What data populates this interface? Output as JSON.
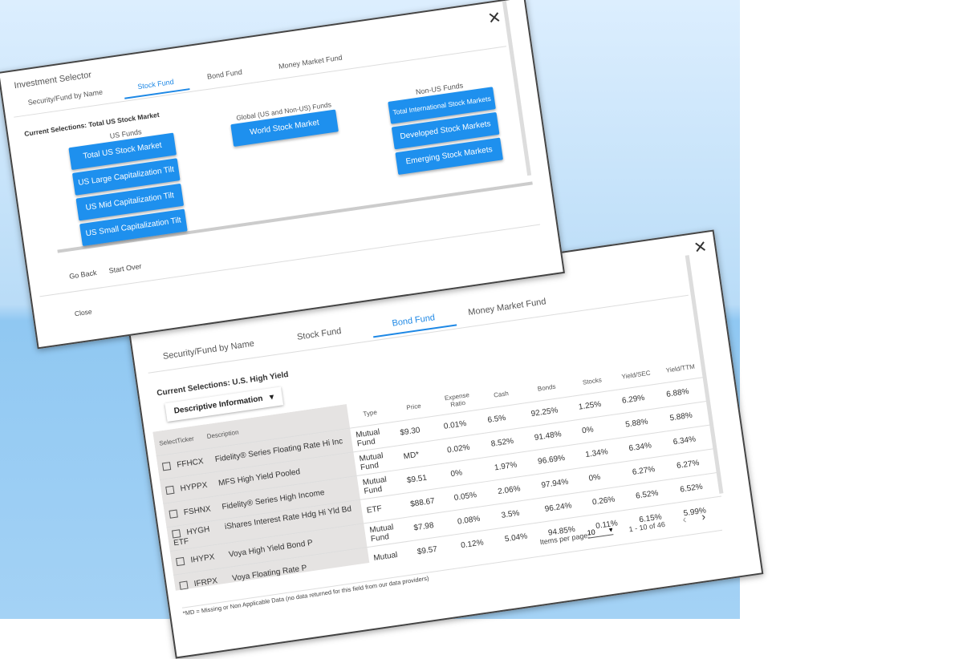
{
  "back_dialog": {
    "close_icon": "close-icon",
    "tabs": [
      "Security/Fund by Name",
      "Stock Fund",
      "Bond Fund",
      "Money Market Fund"
    ],
    "active_tab": "Bond Fund",
    "current_selection": "Current Selections: U.S. High Yield",
    "dropdown_label": "Descriptive Information",
    "columns": {
      "select": "Select",
      "ticker": "Ticker",
      "description": "Description",
      "type": "Type",
      "price": "Price",
      "expense": "Expense Ratio",
      "cash": "Cash",
      "bonds": "Bonds",
      "stocks": "Stocks",
      "yield_sec": "Yield/SEC",
      "yield_ttm": "Yield/TTM"
    },
    "rows": [
      {
        "ticker": "FFHCX",
        "description": "Fidelity® Series Floating Rate Hi Inc",
        "type": "Mutual Fund",
        "price": "$9.30",
        "expense": "0.01%",
        "cash": "6.5%",
        "bonds": "92.25%",
        "stocks": "1.25%",
        "yield_sec": "6.29%",
        "yield_ttm": "6.88%"
      },
      {
        "ticker": "HYPPX",
        "description": "MFS High Yield Pooled",
        "type": "Mutual Fund",
        "price": "MD*",
        "expense": "0.02%",
        "cash": "8.52%",
        "bonds": "91.48%",
        "stocks": "0%",
        "yield_sec": "5.88%",
        "yield_ttm": "5.88%"
      },
      {
        "ticker": "FSHNX",
        "description": "Fidelity® Series High Income",
        "type": "Mutual Fund",
        "price": "$9.51",
        "expense": "0%",
        "cash": "1.97%",
        "bonds": "96.69%",
        "stocks": "1.34%",
        "yield_sec": "6.34%",
        "yield_ttm": "6.34%"
      },
      {
        "ticker": "HYGH",
        "description": "iShares Interest Rate Hdg Hi Yld Bd ETF",
        "type": "ETF",
        "price": "$88.67",
        "expense": "0.05%",
        "cash": "2.06%",
        "bonds": "97.94%",
        "stocks": "0%",
        "yield_sec": "6.27%",
        "yield_ttm": "6.27%"
      },
      {
        "ticker": "IHYPX",
        "description": "Voya High Yield Bond P",
        "type": "Mutual Fund",
        "price": "$7.98",
        "expense": "0.08%",
        "cash": "3.5%",
        "bonds": "96.24%",
        "stocks": "0.26%",
        "yield_sec": "6.52%",
        "yield_ttm": "6.52%"
      },
      {
        "ticker": "IFRPX",
        "description": "Voya Floating Rate P",
        "type": "Mutual",
        "price": "$9.57",
        "expense": "0.12%",
        "cash": "5.04%",
        "bonds": "94.85%",
        "stocks": "0.11%",
        "yield_sec": "6.15%",
        "yield_ttm": "5.99%"
      }
    ],
    "items_per_page_label": "Items per page:",
    "items_per_page_value": "10",
    "range_label": "1 - 10 of 46",
    "footnote": "*MD = Missing or Non Applicable Data (no data returned for this field from our data providers)"
  },
  "front_dialog": {
    "close_icon": "close-icon",
    "title": "Investment Selector",
    "tabs": [
      "Security/Fund by Name",
      "Stock Fund",
      "Bond Fund",
      "Money Market Fund"
    ],
    "active_tab": "Stock Fund",
    "current_selection": "Current Selections: Total US Stock Market",
    "us_funds_label": "US Funds",
    "us_funds": [
      "Total US Stock Market",
      "US Large Capitalization Tilt",
      "US Mid Capitalization Tilt",
      "US Small Capitalization Tilt"
    ],
    "global_label": "Global (US and Non-US) Funds",
    "global_funds": [
      "World Stock Market"
    ],
    "non_us_label": "Non-US Funds",
    "non_us_funds": [
      "Total International Stock Markets",
      "Developed Stock Markets",
      "Emerging Stock Markets"
    ],
    "go_back": "Go Back",
    "start_over": "Start Over",
    "close": "Close"
  },
  "colors": {
    "accent": "#1e90ee",
    "tab_active": "#1e88e5"
  }
}
